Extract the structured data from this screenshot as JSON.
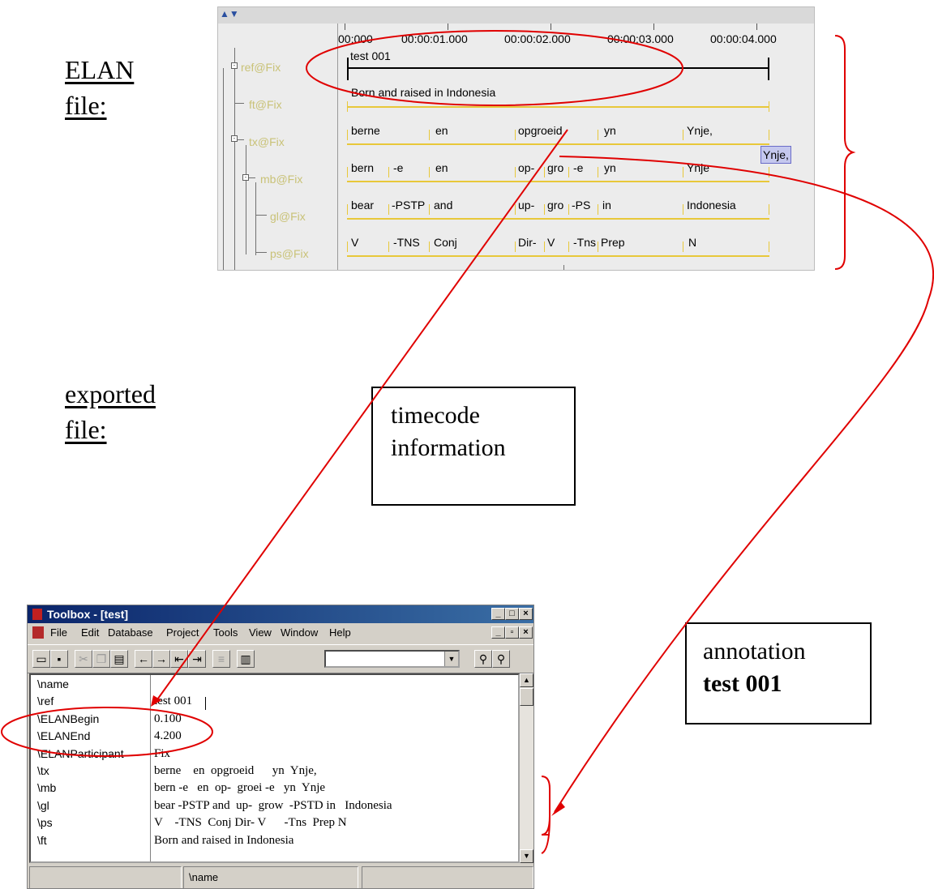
{
  "labels": {
    "elan_file": [
      "ELAN",
      "file:"
    ],
    "exported_file": [
      "exported",
      "file:"
    ]
  },
  "elan": {
    "ruler": [
      "00:000",
      "00:00:01.000",
      "00:00:02.000",
      "00:00:03.000",
      "00:00:04.000"
    ],
    "tiers": [
      "ref@Fix",
      "ft@Fix",
      "tx@Fix",
      "mb@Fix",
      "gl@Fix",
      "ps@Fix"
    ],
    "ref_annotation": "test 001",
    "ft_annotation": "Born and raised in Indonesia",
    "tx_row": [
      "berne",
      "en",
      "opgroeid",
      "yn",
      "Ynje,"
    ],
    "mb_row": [
      "bern",
      "-e",
      "en",
      "op-",
      "gro",
      "-e",
      "yn",
      "Ynje"
    ],
    "gl_row": [
      "bear",
      "-PSTP",
      "and",
      "up-",
      "gro",
      "-PS",
      "in",
      "Indonesia"
    ],
    "ps_row": [
      "V",
      "-TNS",
      "Conj",
      "Dir-",
      "V",
      "-Tns",
      "Prep",
      "N"
    ],
    "selected_edit": "Ynje,"
  },
  "notes": {
    "timecode": [
      "timecode",
      "information"
    ],
    "annotation_line1": "annotation",
    "annotation_line2": "test 001"
  },
  "toolbox": {
    "title": "Toolbox - [test]",
    "menu": [
      "File",
      "Edit",
      "Database",
      "Project",
      "Tools",
      "View",
      "Window",
      "Help"
    ],
    "combo_value": "",
    "records": [
      {
        "marker": "\\name",
        "value": ""
      },
      {
        "marker": "\\ref",
        "value": "test 001"
      },
      {
        "marker": "\\ELANBegin",
        "value": "0.100"
      },
      {
        "marker": "\\ELANEnd",
        "value": "4.200"
      },
      {
        "marker": "\\ELANParticipant",
        "value": "Fix"
      },
      {
        "marker": "\\tx",
        "value": "berne    en  opgroeid      yn  Ynje,"
      },
      {
        "marker": "\\mb",
        "value": "bern -e   en  op-  groei -e   yn  Ynje"
      },
      {
        "marker": "\\gl",
        "value": "bear -PSTP and  up-  grow  -PSTD in   Indonesia"
      },
      {
        "marker": "\\ps",
        "value": "V    -TNS  Conj Dir- V      -Tns  Prep N"
      },
      {
        "marker": "\\ft",
        "value": "Born and raised in Indonesia"
      }
    ],
    "status_panels": [
      "",
      "\\name",
      ""
    ]
  },
  "colors": {
    "annotation_marks": "#e00000",
    "tier_lines": "#e8c83a",
    "tier_names": "#c9c277",
    "titlebar": "#0a246a"
  }
}
